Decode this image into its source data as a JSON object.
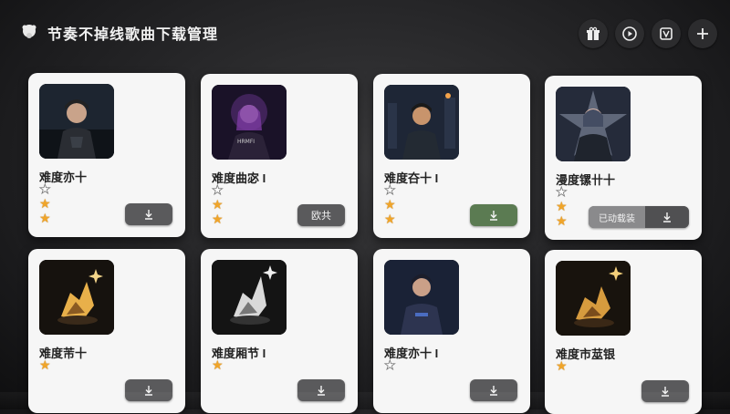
{
  "app": {
    "title": "节奏不掉线歌曲下载管理"
  },
  "top_actions": [
    {
      "icon": "gift-icon"
    },
    {
      "icon": "play-circle-icon"
    },
    {
      "icon": "tv-icon"
    },
    {
      "icon": "plus-icon"
    }
  ],
  "cards": [
    {
      "title": "难度亦十",
      "stars": [
        "empty",
        "filled",
        "filled"
      ],
      "button": {
        "label": "",
        "icon": "download-icon",
        "style": "gray"
      },
      "art": "hero-warrior"
    },
    {
      "title": "难度曲宓 I",
      "stars": [
        "empty",
        "filled",
        "filled"
      ],
      "button": {
        "label": "欧共",
        "icon": "",
        "style": "gray"
      },
      "art": "purple-girl"
    },
    {
      "title": "难度夻十 I",
      "stars": [
        "empty",
        "filled",
        "filled"
      ],
      "button": {
        "label": "",
        "icon": "download-icon",
        "style": "green"
      },
      "art": "city-boy"
    },
    {
      "title": "漫度镙卄十",
      "stars": [
        "empty",
        "filled",
        "filled"
      ],
      "button": {
        "label": "已动载装",
        "icon": "download-icon",
        "style": "split"
      },
      "art": "star-girl"
    },
    {
      "title": "难度芾十",
      "stars": [
        "filled"
      ],
      "button": {
        "label": "",
        "icon": "download-icon",
        "style": "gray"
      },
      "art": "gold-crystal"
    },
    {
      "title": "难度厢节 I",
      "stars": [
        "filled"
      ],
      "button": {
        "label": "",
        "icon": "download-icon",
        "style": "gray"
      },
      "art": "silver-crystal"
    },
    {
      "title": "难度亦十 I",
      "stars": [
        "empty"
      ],
      "button": {
        "label": "",
        "icon": "download-icon",
        "style": "gray"
      },
      "art": "blue-hero"
    },
    {
      "title": "难度市莁银",
      "stars": [
        "filled"
      ],
      "button": {
        "label": "",
        "icon": "download-icon",
        "style": "gray"
      },
      "art": "gold-crystal-2"
    }
  ],
  "colors": {
    "star_filled": "#f0a52a",
    "button_gray": "#5a5a5c",
    "button_green": "#5b7b52"
  }
}
